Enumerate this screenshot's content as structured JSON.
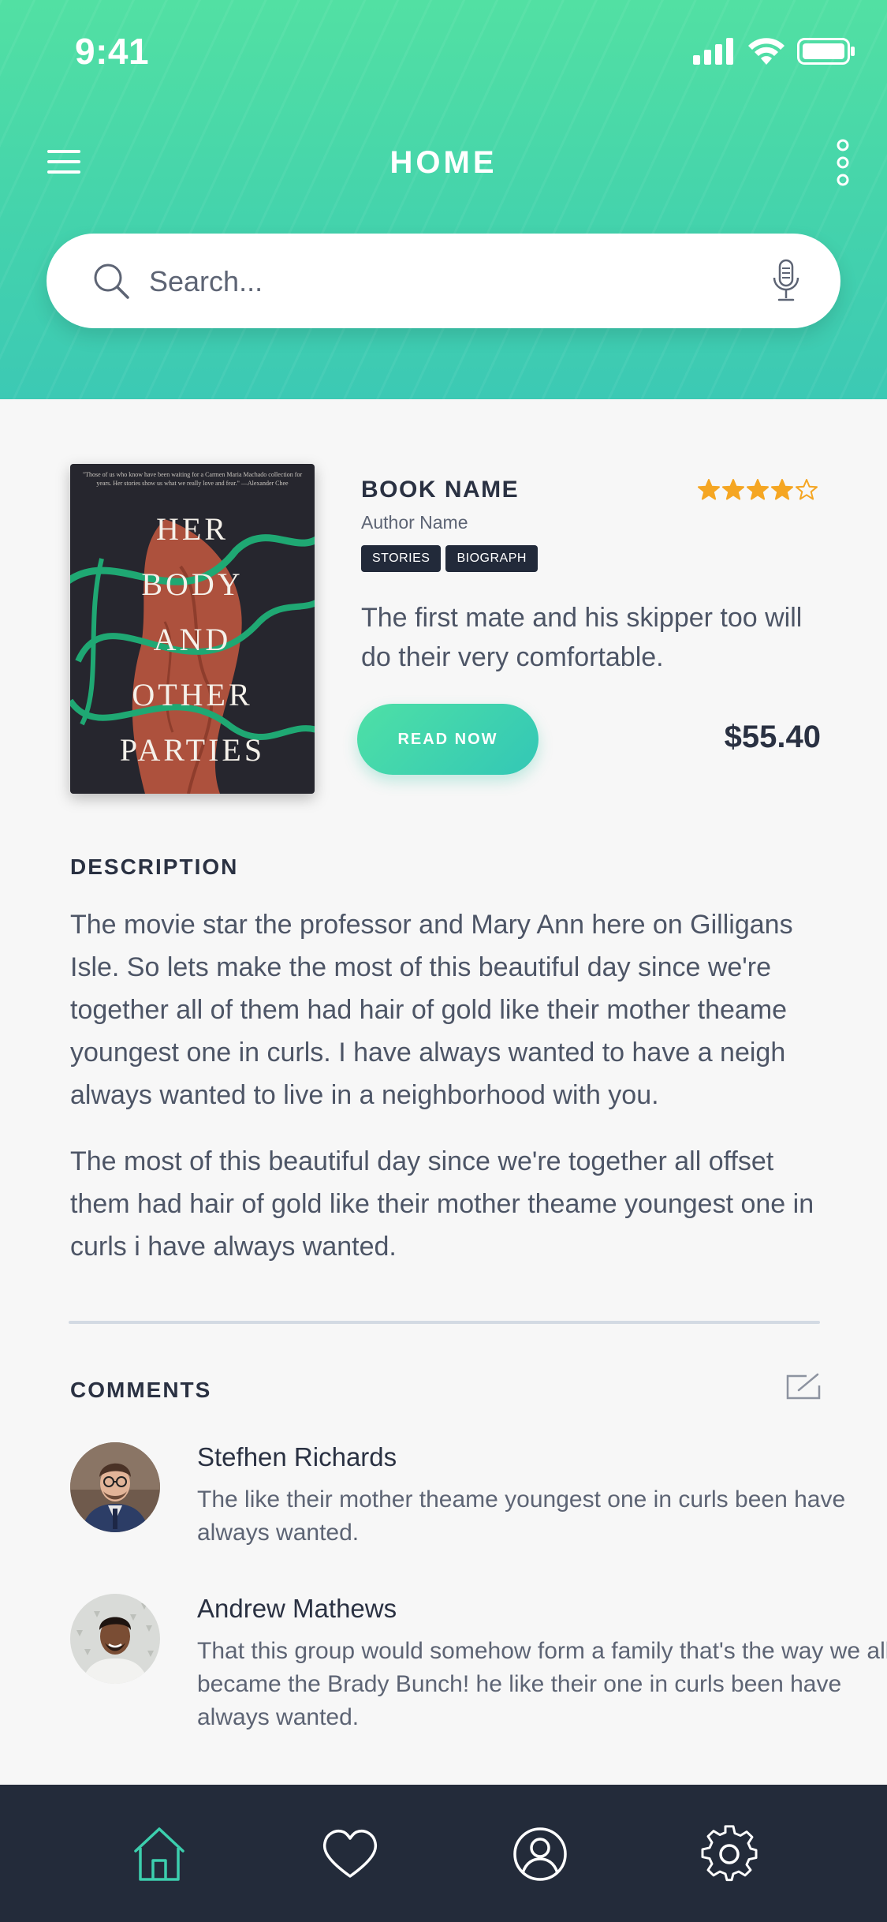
{
  "status": {
    "time": "9:41"
  },
  "header": {
    "title": "HOME"
  },
  "search": {
    "placeholder": "Search..."
  },
  "book": {
    "cover_blurb": "\"Those of us who know have been waiting for a Carmen Maria Machado collection for years. Her stories show us what we really love and fear.\" —Alexander Chee",
    "cover_title_lines": [
      "HER",
      "BODY",
      "AND",
      "OTHER",
      "PARTIES"
    ],
    "name": "BOOK NAME",
    "author": "Author Name",
    "rating": 4,
    "rating_max": 5,
    "tags": [
      "STORIES",
      "BIOGRAPH"
    ],
    "short_description": "The first mate and his skipper too will do their very comfortable.",
    "read_button": "READ NOW",
    "price": "$55.40"
  },
  "description": {
    "title": "DESCRIPTION",
    "paragraphs": [
      "The movie star the professor and Mary Ann here on Gilligans Isle. So lets make the most of this beautiful day since we're together all of them had hair of gold like their mother theame youngest one in curls. I have always wanted to have a neigh always wanted to live in a neighborhood with you.",
      "The most of this beautiful day since we're together all offset them had hair of gold like their mother theame youngest one in curls i have always wanted."
    ]
  },
  "comments": {
    "title": "COMMENTS",
    "items": [
      {
        "name": "Stefhen Richards",
        "text": "The like their mother theame youngest one in curls been have always wanted."
      },
      {
        "name": "Andrew Mathews",
        "text": "That this group would somehow form a family that's the way we all became the Brady Bunch! he like their one in curls been have always wanted."
      }
    ]
  },
  "tabs": [
    {
      "icon": "home-icon",
      "active": true
    },
    {
      "icon": "heart-icon",
      "active": false
    },
    {
      "icon": "profile-icon",
      "active": false
    },
    {
      "icon": "settings-icon",
      "active": false
    }
  ],
  "colors": {
    "accent": "#3ccfae",
    "star": "#f5a623",
    "tabbar": "#232b3a",
    "tag_bg": "#222a3a"
  }
}
